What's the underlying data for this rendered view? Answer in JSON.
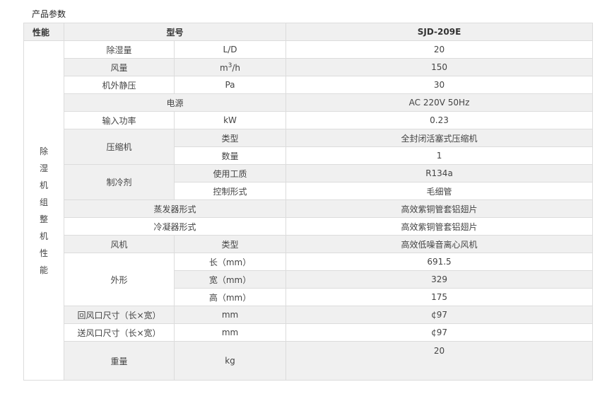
{
  "title": "产品参数",
  "header": {
    "perf": "性能",
    "model_label": "型号",
    "model": "SJD-209E"
  },
  "side_chars": [
    "除",
    "湿",
    "机",
    "组",
    "整",
    "机",
    "性",
    "能"
  ],
  "rows": {
    "dehum": {
      "name": "除湿量",
      "unit": "L/D",
      "value": "20"
    },
    "air": {
      "name": "风量",
      "unit_base": "m",
      "unit_sup": "3",
      "unit_tail": "/h",
      "value": "150"
    },
    "pressure": {
      "name": "机外静压",
      "unit": "Pa",
      "value": "30"
    },
    "power": {
      "name": "电源",
      "value": "AC 220V 50Hz"
    },
    "input": {
      "name": "输入功率",
      "unit": "kW",
      "value": "0.23"
    },
    "compressor": {
      "name": "压缩机",
      "type_label": "类型",
      "type_value": "全封闭活塞式压缩机",
      "qty_label": "数量",
      "qty_value": "1"
    },
    "refrigerant": {
      "name": "制冷剂",
      "medium_label": "使用工质",
      "medium_value": "R134a",
      "control_label": "控制形式",
      "control_value": "毛细管"
    },
    "evaporator": {
      "name": "蒸发器形式",
      "value": "高效紫铜管套铝翅片"
    },
    "condenser": {
      "name": "冷凝器形式",
      "value": "高效紫铜管套铝翅片"
    },
    "fan": {
      "name": "风机",
      "type_label": "类型",
      "value": "高效低噪音离心风机"
    },
    "shape": {
      "name": "外形",
      "l_label": "长（mm）",
      "l_value": "691.5",
      "w_label": "宽（mm）",
      "w_value": "329",
      "h_label": "高（mm）",
      "h_value": "175"
    },
    "return_air": {
      "name": "回风口尺寸（长×宽）",
      "unit": "mm",
      "value": "¢97"
    },
    "supply_air": {
      "name": "送风口尺寸（长×宽）",
      "unit": "mm",
      "value": "¢97"
    },
    "weight": {
      "name": "重量",
      "unit": "kg",
      "value": "20"
    }
  }
}
